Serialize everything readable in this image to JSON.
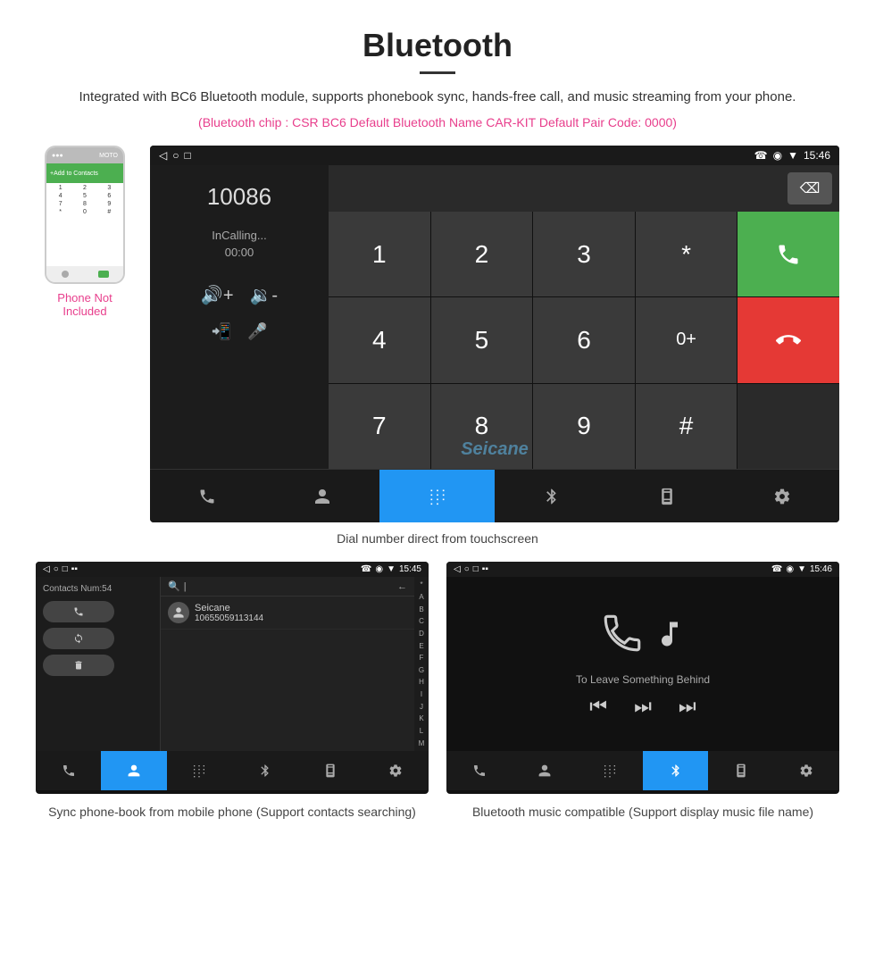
{
  "header": {
    "title": "Bluetooth",
    "description": "Integrated with BC6 Bluetooth module, supports phonebook sync, hands-free call, and music streaming from your phone.",
    "specs": "(Bluetooth chip : CSR BC6    Default Bluetooth Name CAR-KIT    Default Pair Code: 0000)"
  },
  "phone_thumbnail": {
    "label": "Phone Not Included",
    "add_to_contacts": "Add to Contacts"
  },
  "car_screen": {
    "status_bar": {
      "left_icons": [
        "◁",
        "○",
        "□"
      ],
      "right_icons": [
        "☎",
        "◉",
        "▼",
        "15:46"
      ]
    },
    "number": "10086",
    "calling_label": "InCalling...",
    "time": "00:00",
    "dialpad_keys": [
      "1",
      "2",
      "3",
      "*",
      "4",
      "5",
      "6",
      "0+",
      "7",
      "8",
      "9",
      "#"
    ],
    "call_green": "📞",
    "call_red": "📵",
    "watermark": "Seicane",
    "nav_items": [
      "📞",
      "👤",
      "⊞",
      "🎵",
      "📱",
      "⚙"
    ],
    "active_nav": 2
  },
  "main_caption": "Dial number direct from touchscreen",
  "contacts_screen": {
    "status_bar": {
      "left": [
        "◁",
        "○",
        "□",
        "▪",
        "▪"
      ],
      "right": [
        "☎",
        "◉",
        "▼",
        "15:45"
      ]
    },
    "contacts_num": "Contacts Num:54",
    "btns": [
      "☎",
      "↻",
      "🗑"
    ],
    "search_placeholder": "🔍  |",
    "back_icon": "←",
    "contact_name": "Seicane",
    "contact_number": "10655059113144",
    "alpha": [
      "*",
      "A",
      "B",
      "C",
      "D",
      "E",
      "F",
      "G",
      "H",
      "I",
      "J",
      "K",
      "L",
      "M"
    ],
    "nav_items": [
      "📞",
      "👤",
      "⊞",
      "🎵",
      "📱",
      "⚙"
    ],
    "active_nav": 1
  },
  "music_screen": {
    "status_bar": {
      "left": [
        "◁",
        "○",
        "□",
        "▪",
        "▪"
      ],
      "right": [
        "☎",
        "◉",
        "▼",
        "15:46"
      ]
    },
    "song_title": "To Leave Something Behind",
    "controls": [
      "|◀",
      "▶|",
      "▶|"
    ],
    "nav_items": [
      "📞",
      "👤",
      "⊞",
      "🎵",
      "📱",
      "⚙"
    ],
    "active_nav": 3
  },
  "bottom_captions": {
    "contacts": "Sync phone-book from mobile phone\n(Support contacts searching)",
    "music": "Bluetooth music compatible\n(Support display music file name)"
  }
}
